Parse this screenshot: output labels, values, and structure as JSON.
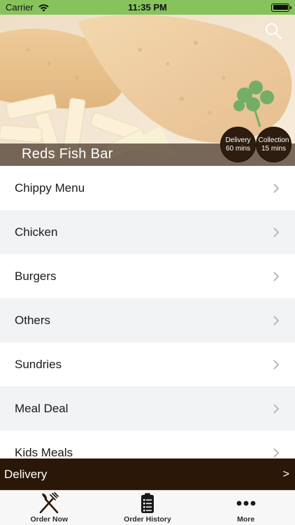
{
  "status_bar": {
    "carrier": "Carrier",
    "time": "11:35 PM",
    "background": "#86c35c"
  },
  "hero": {
    "restaurant_name": "Reds Fish Bar",
    "badges": {
      "delivery": {
        "label": "Delivery",
        "time": "60 mins"
      },
      "collection": {
        "label": "Collection",
        "time": "15 mins"
      }
    }
  },
  "menu": {
    "items": [
      {
        "label": "Chippy Menu"
      },
      {
        "label": "Chicken"
      },
      {
        "label": "Burgers"
      },
      {
        "label": "Others"
      },
      {
        "label": "Sundries"
      },
      {
        "label": "Meal Deal"
      },
      {
        "label": "Kids Meals"
      }
    ]
  },
  "delivery_bar": {
    "label": "Delivery",
    "arrow": ">",
    "background": "#2b1708"
  },
  "tabs": [
    {
      "label": "Order Now",
      "icon": "fork-knife-icon"
    },
    {
      "label": "Order History",
      "icon": "clipboard-list-icon"
    },
    {
      "label": "More",
      "icon": "more-dots-icon"
    }
  ]
}
